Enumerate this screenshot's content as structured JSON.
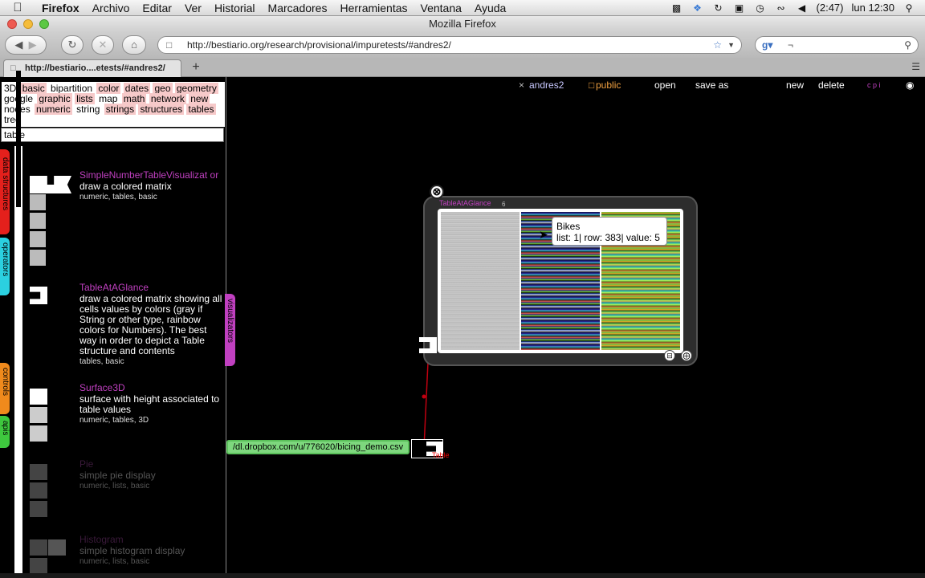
{
  "menubar": {
    "items": [
      "Firefox",
      "Archivo",
      "Editar",
      "Ver",
      "Historial",
      "Marcadores",
      "Herramientas",
      "Ventana",
      "Ayuda"
    ],
    "battery": "(2:47)",
    "clock": "lun 12:30"
  },
  "window": {
    "title": "Mozilla Firefox"
  },
  "toolbar": {
    "url": "http://bestiario.org/research/provisional/impuretests/#andres2/",
    "search_value": "¬"
  },
  "tab": {
    "label": "http://bestiario....etests/#andres2/",
    "new_tab_label": "+"
  },
  "left_panel": {
    "tags": [
      {
        "t": "3D",
        "hl": false
      },
      {
        "t": "basic",
        "hl": true
      },
      {
        "t": "bipartition",
        "hl": false
      },
      {
        "t": "color",
        "hl": true
      },
      {
        "t": "dates",
        "hl": true
      },
      {
        "t": "geo",
        "hl": true
      },
      {
        "t": "geometry",
        "hl": true
      },
      {
        "t": "google",
        "hl": false
      },
      {
        "t": "graphic",
        "hl": true
      },
      {
        "t": "lists",
        "hl": true
      },
      {
        "t": "map",
        "hl": false
      },
      {
        "t": "math",
        "hl": true
      },
      {
        "t": "network",
        "hl": true
      },
      {
        "t": "new",
        "hl": true
      },
      {
        "t": "nodes",
        "hl": false
      },
      {
        "t": "numeric",
        "hl": true
      },
      {
        "t": "string",
        "hl": false
      },
      {
        "t": "strings",
        "hl": true
      },
      {
        "t": "structures",
        "hl": true
      },
      {
        "t": "tables",
        "hl": true
      },
      {
        "t": "tree",
        "hl": false
      }
    ],
    "search_value": "table",
    "side_tabs": [
      "data structures",
      "operators",
      "visualizators",
      "controls",
      "apis"
    ],
    "modules": [
      {
        "title": "SimpleNumberTableVisualizat or",
        "desc": "draw a colored matrix",
        "tags": "numeric, tables, basic"
      },
      {
        "title": "TableAtAGlance",
        "desc": "draw a colored matrix showing all cells values by colors (gray if String or other type, rainbow colors for Numbers). The best way in order to depict a Table structure and contents",
        "tags": "tables, basic"
      },
      {
        "title": "Surface3D",
        "desc": "surface with height associated to table values",
        "tags": "numeric, tables, 3D"
      },
      {
        "title": "Pie",
        "desc": "simple pie display",
        "tags": "numeric, lists, basic"
      },
      {
        "title": "Histogram",
        "desc": "simple histogram display",
        "tags": "numeric, lists, basic"
      }
    ]
  },
  "canvas_bar": {
    "close_x": "×",
    "name": "andres2",
    "public_label": "public",
    "open": "open",
    "save_as": "save as",
    "new": "new",
    "delete": "delete",
    "cpi": "c p i"
  },
  "viz": {
    "title": "TableAtAGlance",
    "sub": "6",
    "tooltip_title": "Bikes",
    "tooltip_body": "list: 1| row: 383| value: 5",
    "close_symbol": "⊗"
  },
  "url_node": {
    "value": "/dl.dropbox.com/u/776020/bicing_demo.csv",
    "table_label": "Table"
  }
}
